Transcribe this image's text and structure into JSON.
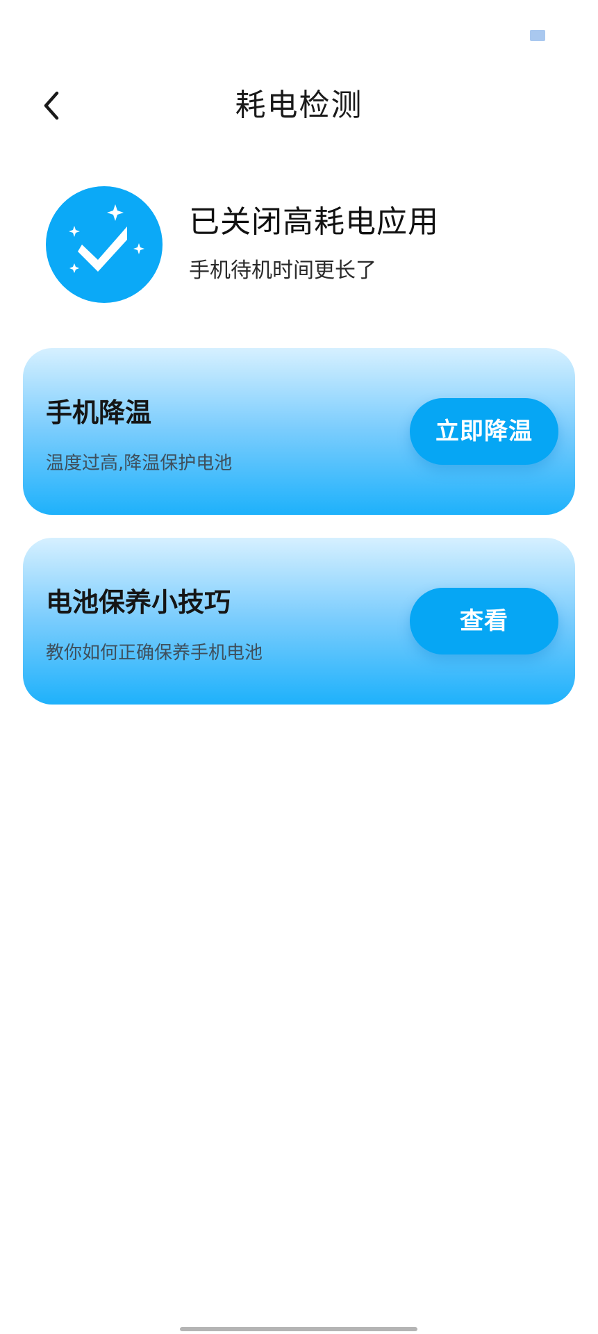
{
  "header": {
    "title": "耗电检测",
    "back_icon": "chevron-left-icon"
  },
  "result": {
    "icon": "check-sparkle-icon",
    "title": "已关闭高耗电应用",
    "subtitle": "手机待机时间更长了"
  },
  "cards": [
    {
      "title": "手机降温",
      "description": "温度过高,降温保护电池",
      "button_label": "立即降温"
    },
    {
      "title": "电池保养小技巧",
      "description": "教你如何正确保养手机电池",
      "button_label": "查看"
    }
  ],
  "colors": {
    "accent": "#06a6f4",
    "icon_circle": "#0ba9f7",
    "status_indicator": "#a9c8ef"
  }
}
